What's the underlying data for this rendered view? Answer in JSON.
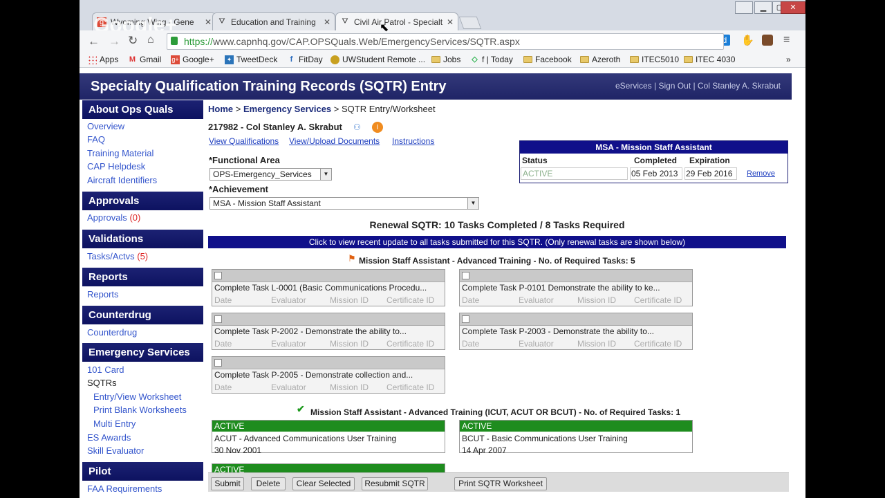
{
  "browser": {
    "tabs": [
      {
        "label": "Wyoming Wing - Gene",
        "icon": "g-icon",
        "active": false
      },
      {
        "label": "Education and Training",
        "icon": "cap-icon",
        "active": false
      },
      {
        "label": "Civil Air Patrol - Specialt",
        "icon": "cap-icon",
        "active": true
      }
    ],
    "url_scheme": "https://",
    "url_rest": "www.capnhq.gov/CAP.OPSQuals.Web/EmergencyServices/SQTR.aspx",
    "overlay_logo": "Google+",
    "bookmarks": [
      {
        "label": "Apps",
        "icon": "apps-icon"
      },
      {
        "label": "Gmail",
        "icon": "gmail-icon"
      },
      {
        "label": "Google+",
        "icon": "googleplus-icon"
      },
      {
        "label": "TweetDeck",
        "icon": "tweetdeck-icon"
      },
      {
        "label": "FitDay",
        "icon": "fitday-icon"
      },
      {
        "label": "UWStudent Remote ...",
        "icon": "uw-icon"
      },
      {
        "label": "Jobs",
        "icon": "folder-icon"
      },
      {
        "label": "f | Today",
        "icon": "feedly-icon"
      },
      {
        "label": "Facebook",
        "icon": "folder-icon"
      },
      {
        "label": "Azeroth",
        "icon": "folder-icon"
      },
      {
        "label": "ITEC5010",
        "icon": "folder-icon"
      },
      {
        "label": "ITEC 4030",
        "icon": "folder-icon"
      }
    ],
    "more_bookmarks": "»"
  },
  "banner": {
    "title": "Specialty Qualification Training Records (SQTR) Entry",
    "links": "eServices | Sign Out | Col Stanley A. Skrabut"
  },
  "sidebar": {
    "about": {
      "heading": "About Ops Quals",
      "links": [
        "Overview",
        "FAQ",
        "Training Material",
        "CAP Helpdesk",
        "Aircraft Identifiers"
      ]
    },
    "approvals": {
      "heading": "Approvals",
      "link": "Approvals",
      "count": "(0)"
    },
    "validations": {
      "heading": "Validations",
      "link": "Tasks/Actvs",
      "count": "(5)"
    },
    "reports": {
      "heading": "Reports",
      "link": "Reports"
    },
    "counterdrug": {
      "heading": "Counterdrug",
      "link": "Counterdrug"
    },
    "es": {
      "heading": "Emergency Services",
      "card": "101 Card",
      "sqtrs": "SQTRs",
      "sub": [
        "Entry/View Worksheet",
        "Print Blank Worksheets",
        "Multi Entry"
      ],
      "awards": "ES Awards",
      "skill": "Skill Evaluator"
    },
    "pilot": {
      "heading": "Pilot",
      "link": "FAA Requirements"
    }
  },
  "breadcrumb": {
    "home": "Home",
    "es": "Emergency Services",
    "current": "> SQTR Entry/Worksheet",
    "sep": ">"
  },
  "member": {
    "name": "217982 - Col Stanley A. Skrabut",
    "links": [
      "View Qualifications",
      "View/Upload Documents",
      "Instructions"
    ]
  },
  "form": {
    "functional_label": "*Functional Area",
    "functional_value": "OPS-Emergency_Services",
    "achievement_label": "*Achievement",
    "achievement_value": "MSA - Mission Staff Assistant"
  },
  "msa_box": {
    "title": "MSA - Mission Staff Assistant",
    "headers": [
      "Status",
      "Completed",
      "Expiration"
    ],
    "status": "ACTIVE",
    "completed": "05 Feb 2013",
    "expiration": "29 Feb 2016",
    "remove": "Remove"
  },
  "renewal": {
    "summary": "Renewal SQTR: 10 Tasks Completed / 8 Tasks Required",
    "notice": "Click to view recent update to all tasks submitted for this SQTR. (Only renewal tasks are shown below)"
  },
  "section1": {
    "title": "Mission Staff Assistant - Advanced Training - No. of Required Tasks: 5",
    "fields": [
      "Date",
      "Evaluator",
      "Mission ID",
      "Certificate ID"
    ],
    "tasks": [
      "Complete Task L-0001 (Basic Communications Procedu...",
      "Complete Task P-0101 Demonstrate the ability to ke...",
      "Complete Task P-2002 - Demonstrate the ability to...",
      "Complete Task P-2003 - Demonstrate the ability to...",
      "Complete Task P-2005 - Demonstrate collection and..."
    ]
  },
  "section2": {
    "title": "Mission Staff Assistant - Advanced Training (ICUT, ACUT OR BCUT) - No. of Required Tasks: 1",
    "items": [
      {
        "status": "ACTIVE",
        "name": "ACUT - Advanced Communications User Training",
        "date": "30 Nov 2001"
      },
      {
        "status": "ACTIVE",
        "name": "BCUT - Basic Communications User Training",
        "date": "14 Apr 2007"
      }
    ],
    "third_status": "ACTIVE"
  },
  "buttons": [
    "Submit",
    "Delete",
    "Clear Selected",
    "Resubmit SQTR",
    "Print SQTR Worksheet"
  ],
  "colors": {
    "banner": "#1f2466",
    "sidebar_heading": "#0d1260",
    "notice_bar": "#10108a",
    "active_green": "#1e8c1e",
    "link": "#2040c0"
  }
}
